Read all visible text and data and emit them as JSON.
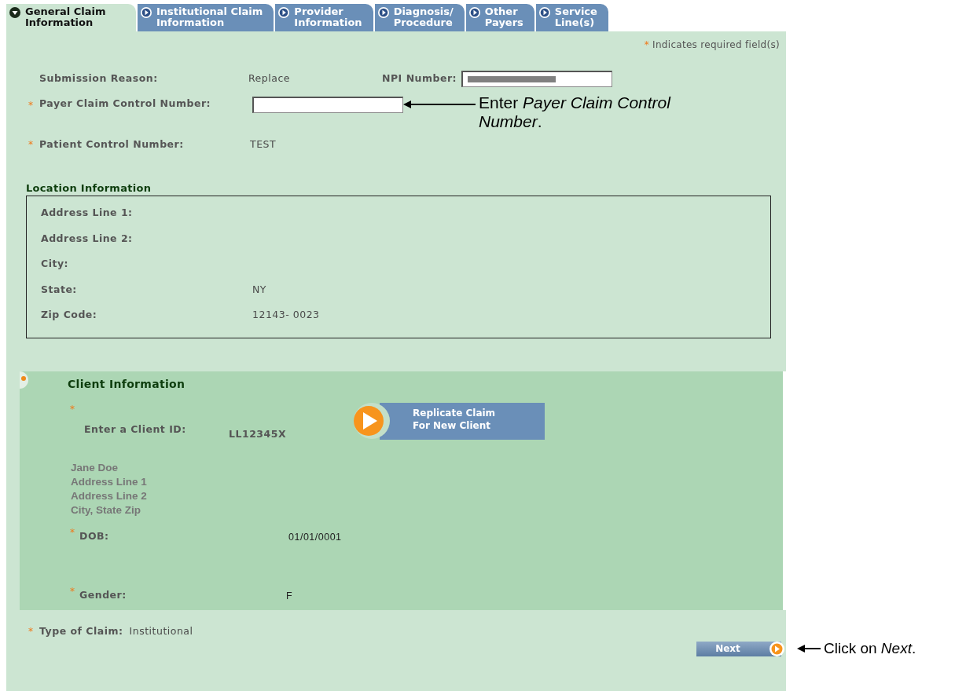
{
  "tabs": [
    {
      "lines": [
        "General Claim",
        "Information"
      ],
      "selected": true
    },
    {
      "lines": [
        "Institutional Claim",
        "Information"
      ],
      "selected": false
    },
    {
      "lines": [
        "Provider",
        "Information"
      ],
      "selected": false
    },
    {
      "lines": [
        "Diagnosis/",
        "Procedure"
      ],
      "selected": false
    },
    {
      "lines": [
        "Other",
        "Payers"
      ],
      "selected": false
    },
    {
      "lines": [
        "Service",
        "Line(s)"
      ],
      "selected": false
    }
  ],
  "required_note": {
    "mark": "*",
    "text": "Indicates required field(s)"
  },
  "submission_reason": {
    "label": "Submission Reason:",
    "value": "Replace"
  },
  "npi": {
    "label": "NPI Number:"
  },
  "payer_claim_control": {
    "required_mark": "*",
    "label": "Payer Claim Control Number:"
  },
  "patient_control": {
    "required_mark": "*",
    "label": "Patient Control Number:",
    "value": "TEST"
  },
  "payer_callout": "Enter *Payer Claim Control Number*.",
  "location": {
    "title": "Location Information",
    "rows": [
      {
        "label": "Address Line 1:"
      },
      {
        "label": "Address Line 2:"
      },
      {
        "label": "City:"
      },
      {
        "label": "State:",
        "value": "NY"
      },
      {
        "label": "Zip Code:",
        "value": "12143- 0023"
      }
    ]
  },
  "client": {
    "title": "Client Information",
    "client_id": {
      "required_mark": "*",
      "label": "Enter a Client ID:",
      "value": "LL12345X"
    },
    "replicate_button": [
      "Replicate Claim",
      "For New Client"
    ],
    "address_lines": [
      "Jane Doe",
      "Address Line 1",
      "Address Line 2",
      "City, State Zip"
    ],
    "dob": {
      "required_mark": "*",
      "label": "DOB:",
      "value": "01/01/0001"
    },
    "gender": {
      "required_mark": "*",
      "label": "Gender:",
      "value": "F"
    }
  },
  "type_of_claim": {
    "required_mark": "*",
    "label": "Type of Claim:",
    "value": "Institutional"
  },
  "next_button": "Next",
  "next_callout": "Click on *Next*."
}
